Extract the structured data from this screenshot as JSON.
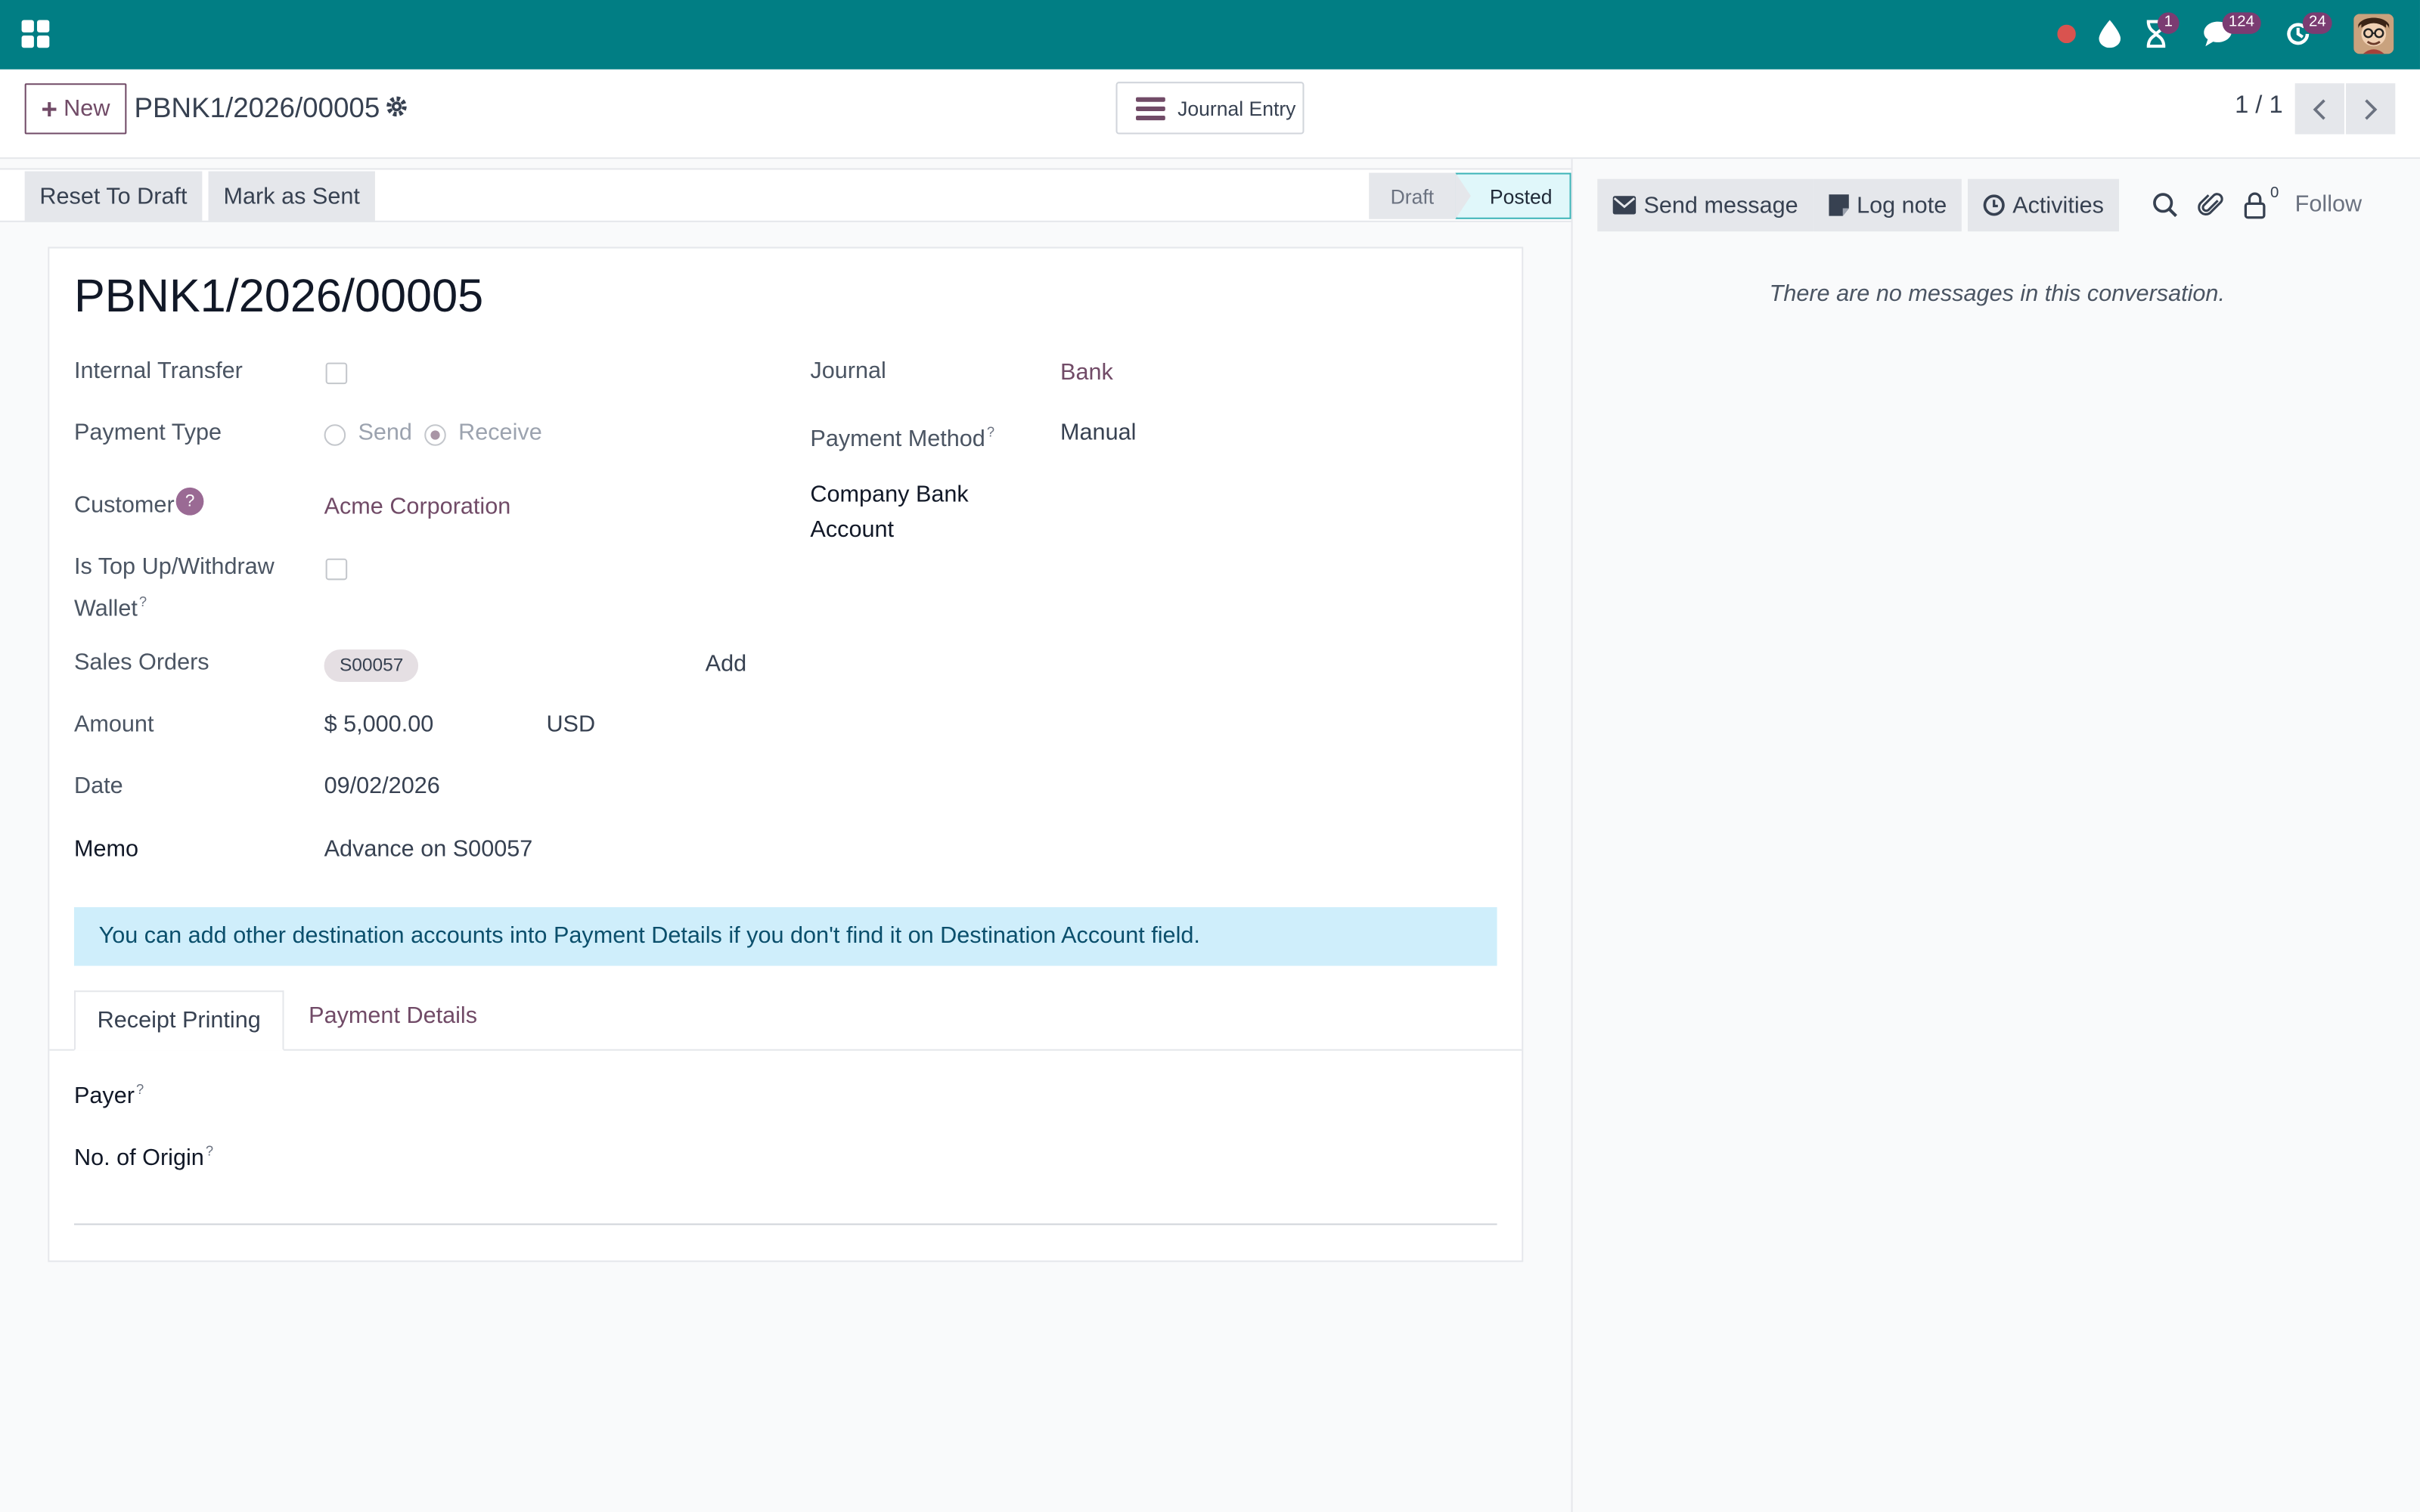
{
  "navbar": {
    "activities_badge": "1",
    "messages_badge": "124",
    "updates_badge": "24"
  },
  "control": {
    "new_label": "New",
    "breadcrumb": "PBNK1/2026/00005",
    "journal_entry_label": "Journal Entry",
    "pager": "1 / 1"
  },
  "status": {
    "reset_label": "Reset To Draft",
    "mark_sent_label": "Mark as Sent",
    "stages": [
      "Draft",
      "Posted"
    ],
    "current_stage": "Posted"
  },
  "form": {
    "title": "PBNK1/2026/00005",
    "internal_transfer_label": "Internal Transfer",
    "internal_transfer": false,
    "payment_type_label": "Payment Type",
    "payment_type_options": [
      "Send",
      "Receive"
    ],
    "payment_type": "Receive",
    "customer_label": "Customer",
    "customer_help": "?",
    "customer": "Acme Corporation",
    "topup_label_1": "Is Top Up/Withdraw",
    "topup_label_2": "Wallet",
    "sales_orders_label": "Sales Orders",
    "sales_order_tag": "S00057",
    "add_label": "Add",
    "amount_label": "Amount",
    "amount": "$ 5,000.00",
    "currency": "USD",
    "date_label": "Date",
    "date": "09/02/2026",
    "memo_label": "Memo",
    "memo": "Advance on S00057",
    "journal_label": "Journal",
    "journal": "Bank",
    "payment_method_label": "Payment Method",
    "payment_method": "Manual",
    "company_bank_label_1": "Company Bank",
    "company_bank_label_2": "Account",
    "help_mark": "?"
  },
  "alert": "You can add other destination accounts into Payment Details if you don't find it on Destination Account field.",
  "tabs": {
    "receipt_printing": "Receipt Printing",
    "payment_details": "Payment Details"
  },
  "receipt": {
    "payer_label": "Payer",
    "origin_label": "No. of Origin"
  },
  "chatter": {
    "send_message": "Send message",
    "log_note": "Log note",
    "activities": "Activities",
    "followers_count": "0",
    "follow": "Follow",
    "no_messages": "There are no messages in this conversation."
  },
  "colors": {
    "navbar": "#017e84",
    "brand": "#714b67",
    "alert_bg": "#cfeefb"
  }
}
